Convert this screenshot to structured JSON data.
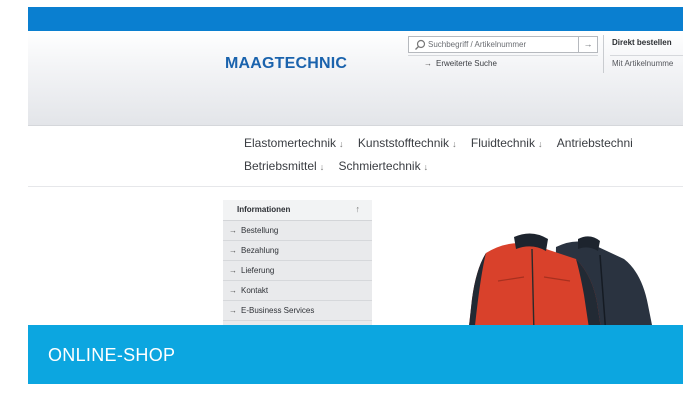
{
  "header": {
    "logo_text": "MAAGTECHNIC",
    "search": {
      "placeholder": "Suchbegriff / Artikelnummer",
      "go_glyph": "→",
      "advanced_arrow": "→",
      "advanced_label": "Erweiterte Suche"
    },
    "direct_order": {
      "title": "Direkt bestellen",
      "placeholder_text": "Mit Artikelnumme"
    }
  },
  "nav": {
    "chevron_glyph": "↓",
    "row1": [
      {
        "label": "Elastomertechnik"
      },
      {
        "label": "Kunststofftechnik"
      },
      {
        "label": "Fluidtechnik"
      },
      {
        "label": "Antriebstechni"
      }
    ],
    "row2": [
      {
        "label": "Betriebsmittel"
      },
      {
        "label": "Schmiertechnik"
      }
    ]
  },
  "info_panel": {
    "title": "Informationen",
    "toggle_glyph": "↑",
    "item_arrow": "→",
    "items": [
      {
        "label": "Bestellung"
      },
      {
        "label": "Bezahlung"
      },
      {
        "label": "Lieferung"
      },
      {
        "label": "Kontakt"
      },
      {
        "label": "E-Business Services"
      }
    ]
  },
  "banner": {
    "label": "ONLINE-SHOP"
  },
  "colors": {
    "topbar": "#0a7fd0",
    "logo": "#1a63ad",
    "banner": "#0ca6e0",
    "jacket_red": "#d9412b",
    "jacket_navy": "#2a3340"
  },
  "icons": {
    "search": "search-icon",
    "product": "jacket-product-photo"
  }
}
